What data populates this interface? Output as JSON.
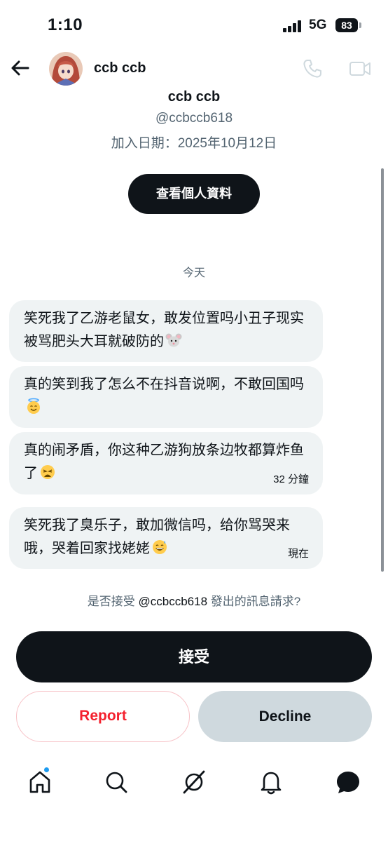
{
  "status_bar": {
    "time": "1:10",
    "network": "5G",
    "battery": "83"
  },
  "header": {
    "name": "ccb ccb",
    "back_icon": "arrow-left-icon",
    "call_icon": "phone-icon",
    "video_icon": "video-icon"
  },
  "profile": {
    "name": "ccb ccb",
    "handle": "@ccbccb618",
    "joined": "加入日期：2025年10月12日",
    "view_profile_label": "查看個人資料"
  },
  "conversation": {
    "date_separator": "今天",
    "messages": [
      {
        "text": "笑死我了乙游老鼠女，敢发位置吗小丑子现实被骂肥头大耳就破防的",
        "emoji": "mouse-face",
        "time": ""
      },
      {
        "text": "真的笑到我了怎么不在抖音说啊，不敢回国吗",
        "emoji": "smiling-face-with-halo",
        "time": ""
      },
      {
        "text": "真的闹矛盾，你这种乙游狗放条边牧都算炸鱼了",
        "emoji": "weary-face",
        "time": "32 分鐘"
      },
      {
        "text": "笑死我了臭乐子，敢加微信吗，给你骂哭来哦，哭着回家找姥姥",
        "emoji": "grinning-face-with-sweat",
        "time": "現在"
      }
    ]
  },
  "request": {
    "prefix": "是否接受",
    "handle": "@ccbccb618",
    "suffix": "發出的訊息請求?"
  },
  "actions": {
    "accept": "接受",
    "report": "Report",
    "decline": "Decline"
  },
  "colors": {
    "primary": "#0f1419",
    "secondary_text": "#536471",
    "bubble": "#eff3f4",
    "report_red": "#f4212e",
    "decline_bg": "#cfd9de",
    "notification_dot": "#1d9bf0"
  },
  "bottom_nav": {
    "items": [
      "home-icon",
      "search-icon",
      "grok-icon",
      "notifications-icon",
      "messages-icon"
    ]
  }
}
